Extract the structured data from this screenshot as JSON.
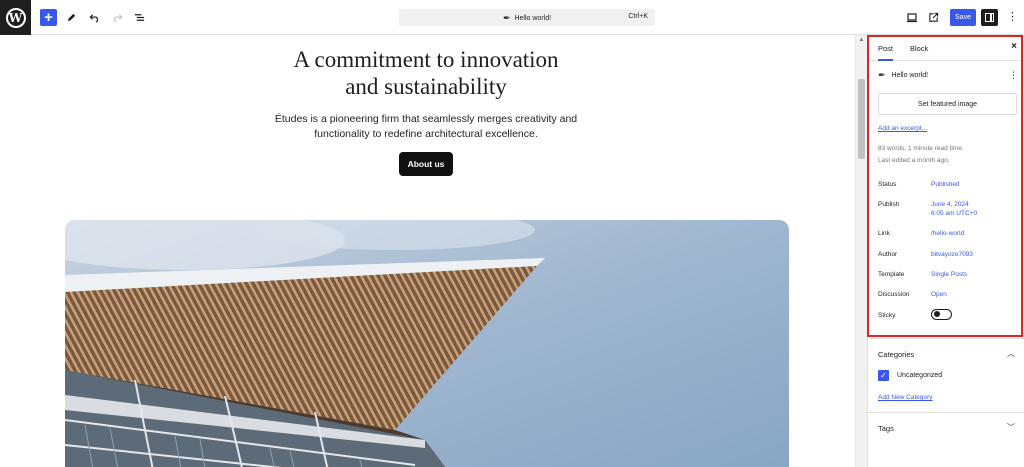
{
  "toolbar": {
    "logo_glyph": "W",
    "add_icon": "+",
    "cmd_title": "Hello world!",
    "cmd_shortcut": "Ctrl+K",
    "save_label": "Save"
  },
  "content": {
    "heading_line1": "A commitment to innovation",
    "heading_line2": "and sustainability",
    "lede_line1": "Études is a pioneering firm that seamlessly merges creativity and",
    "lede_line2": "functionality to redefine architectural excellence.",
    "button_label": "About us"
  },
  "sidebar": {
    "tabs": [
      "Post",
      "Block"
    ],
    "close_glyph": "×",
    "post_title": "Hello world!",
    "featured_image_label": "Set featured image",
    "excerpt_link": "Add an excerpt...",
    "meta_line1": "83 words, 1 minute read time.",
    "meta_line2": "Last edited a month ago.",
    "fields": {
      "status": {
        "label": "Status",
        "value": "Published"
      },
      "publish": {
        "label": "Publish",
        "value_line1": "June 4, 2024",
        "value_line2": "6:05 am UTC+0"
      },
      "link": {
        "label": "Link",
        "value": "/hello-world"
      },
      "author": {
        "label": "Author",
        "value": "bitvayoze7093"
      },
      "template": {
        "label": "Template",
        "value": "Single Posts"
      },
      "discussion": {
        "label": "Discussion",
        "value": "Open"
      },
      "sticky": {
        "label": "Sticky",
        "value": false
      }
    },
    "categories": {
      "title": "Categories",
      "items": [
        {
          "label": "Uncategorized",
          "checked": true
        }
      ],
      "add_new": "Add New Category"
    },
    "tags": {
      "title": "Tags"
    }
  },
  "colors": {
    "accent": "#3858e9",
    "highlight": "#e02424",
    "dark": "#1e1e1e"
  },
  "icons": [
    "wordpress-logo-icon",
    "add-block-icon",
    "pen-tool-icon",
    "undo-icon",
    "redo-icon",
    "list-view-icon",
    "feather-icon",
    "desktop-preview-icon",
    "external-view-icon",
    "sidebar-settings-icon",
    "more-options-icon",
    "close-icon",
    "chevron-up-icon",
    "chevron-down-icon",
    "checkbox-checked-icon"
  ]
}
